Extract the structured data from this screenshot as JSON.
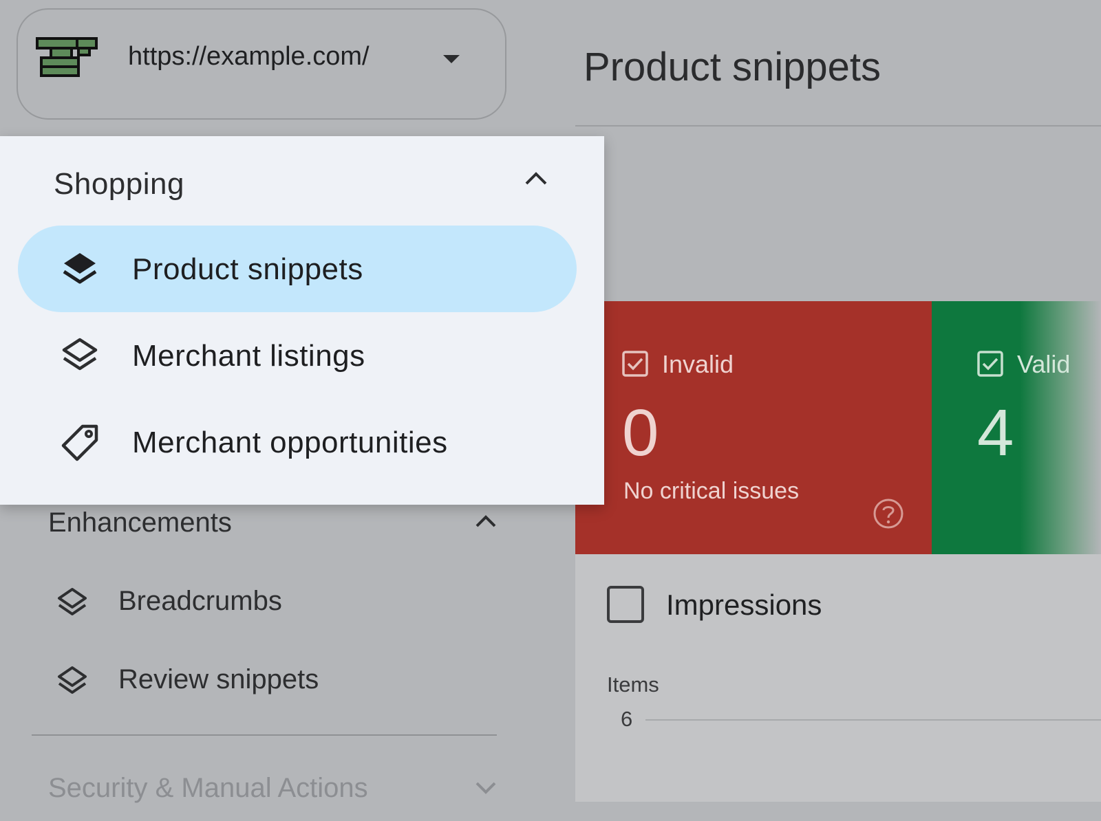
{
  "property": {
    "url": "https://example.com/"
  },
  "page": {
    "title": "Product snippets"
  },
  "menu": {
    "header": "Shopping",
    "items": [
      {
        "label": "Product snippets",
        "icon": "layers-filled-icon",
        "selected": true
      },
      {
        "label": "Merchant listings",
        "icon": "layers-icon",
        "selected": false
      },
      {
        "label": "Merchant opportunities",
        "icon": "tag-icon",
        "selected": false
      }
    ]
  },
  "sidebar": {
    "enhancements": {
      "header": "Enhancements",
      "items": [
        {
          "label": "Breadcrumbs",
          "icon": "layers-icon"
        },
        {
          "label": "Review snippets",
          "icon": "layers-icon"
        }
      ]
    },
    "security": {
      "header": "Security & Manual Actions"
    }
  },
  "cards": {
    "invalid": {
      "label": "Invalid",
      "value": "0",
      "subtext": "No critical issues",
      "color": "#a53129"
    },
    "valid": {
      "label": "Valid",
      "value": "4",
      "color": "#0e783e"
    }
  },
  "chart": {
    "metric_label": "Impressions",
    "y_label": "Items",
    "y_tick": "6"
  },
  "colors": {
    "selected_item": "#c3e7fc",
    "menu_bg": "#eff2f7"
  }
}
